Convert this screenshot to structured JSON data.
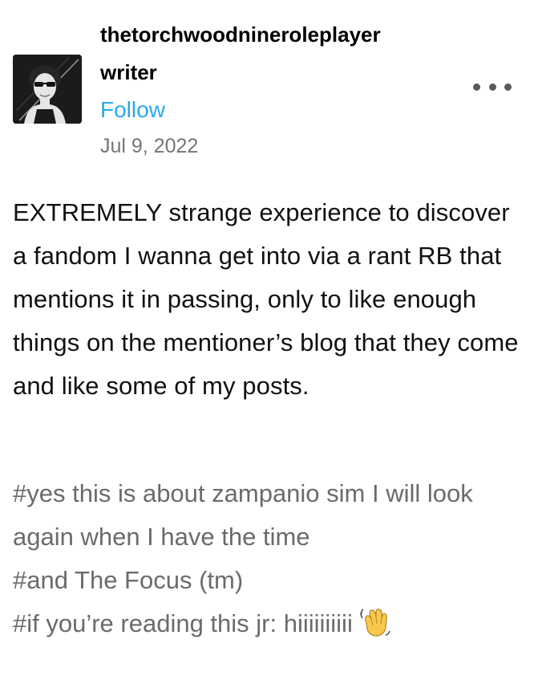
{
  "post": {
    "author": {
      "username": "thetorchwoodnineroleplayer",
      "subtitle": "writer",
      "follow_label": "Follow",
      "avatar_icon": "avatar-image"
    },
    "date": "Jul 9, 2022",
    "more_icon": "more-options-icon",
    "body": "EXTREMELY strange experience to discover a fandom I wanna get into via a rant RB that mentions it in passing, only to like enough things on the mentioner’s blog that they come and like some of my posts.",
    "tags": [
      "#yes this is about zampanio sim I will look again when I have the time",
      "#and The Focus (tm)",
      "#if you’re reading this jr: hiiiiiiiiii"
    ],
    "tag_emoji": "waving-hand-emoji",
    "colors": {
      "follow": "#2aa7f0",
      "date": "#757575",
      "tags": "#6b6b6b",
      "text": "#111111"
    }
  }
}
